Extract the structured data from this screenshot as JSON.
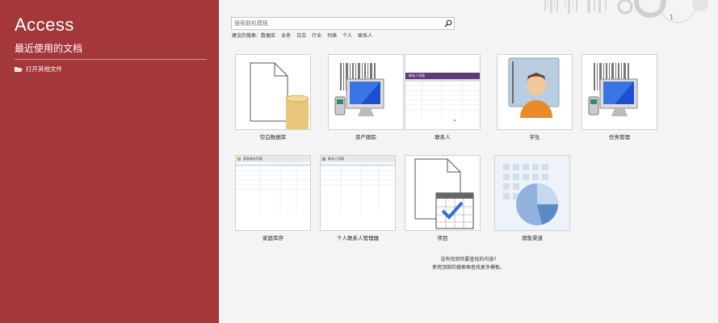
{
  "sidebar": {
    "app_title": "Access",
    "recent_title": "最近使用的文档",
    "open_files": "打开其他文件",
    "folder_icon": "folder-open-icon"
  },
  "search": {
    "placeholder": "搜索联机模板",
    "icon": "search-icon"
  },
  "suggested": {
    "label": "建议的搜索:",
    "items": [
      "数据库",
      "业务",
      "日志",
      "行业",
      "列表",
      "个人",
      "联系人"
    ]
  },
  "templates": [
    {
      "name": "空白数据库",
      "icon": "blank-database-icon"
    },
    {
      "name": "资产跟踪",
      "icon": "asset-tracking-icon"
    },
    {
      "name": "联系人",
      "icon": "contacts-icon",
      "window_title": "联系人列表"
    },
    {
      "name": "学生",
      "icon": "student-icon"
    },
    {
      "name": "任务管理",
      "icon": "task-management-icon"
    },
    {
      "name": "家庭库存",
      "icon": "home-inventory-icon",
      "window_title": "家庭库存列表"
    },
    {
      "name": "个人联系人管理器",
      "icon": "personal-contacts-icon",
      "window_title": "联系人列表"
    },
    {
      "name": "项目",
      "icon": "project-icon"
    },
    {
      "name": "销售渠道",
      "icon": "sales-pipeline-icon"
    }
  ],
  "not_found": {
    "title": "没有找到你要查找的内容?",
    "hint": "使用顶部的搜索框查找更多模板。"
  },
  "colors": {
    "accent": "#a4373a",
    "background": "#f4f4f4",
    "db_cylinder": "#e8c57a"
  }
}
